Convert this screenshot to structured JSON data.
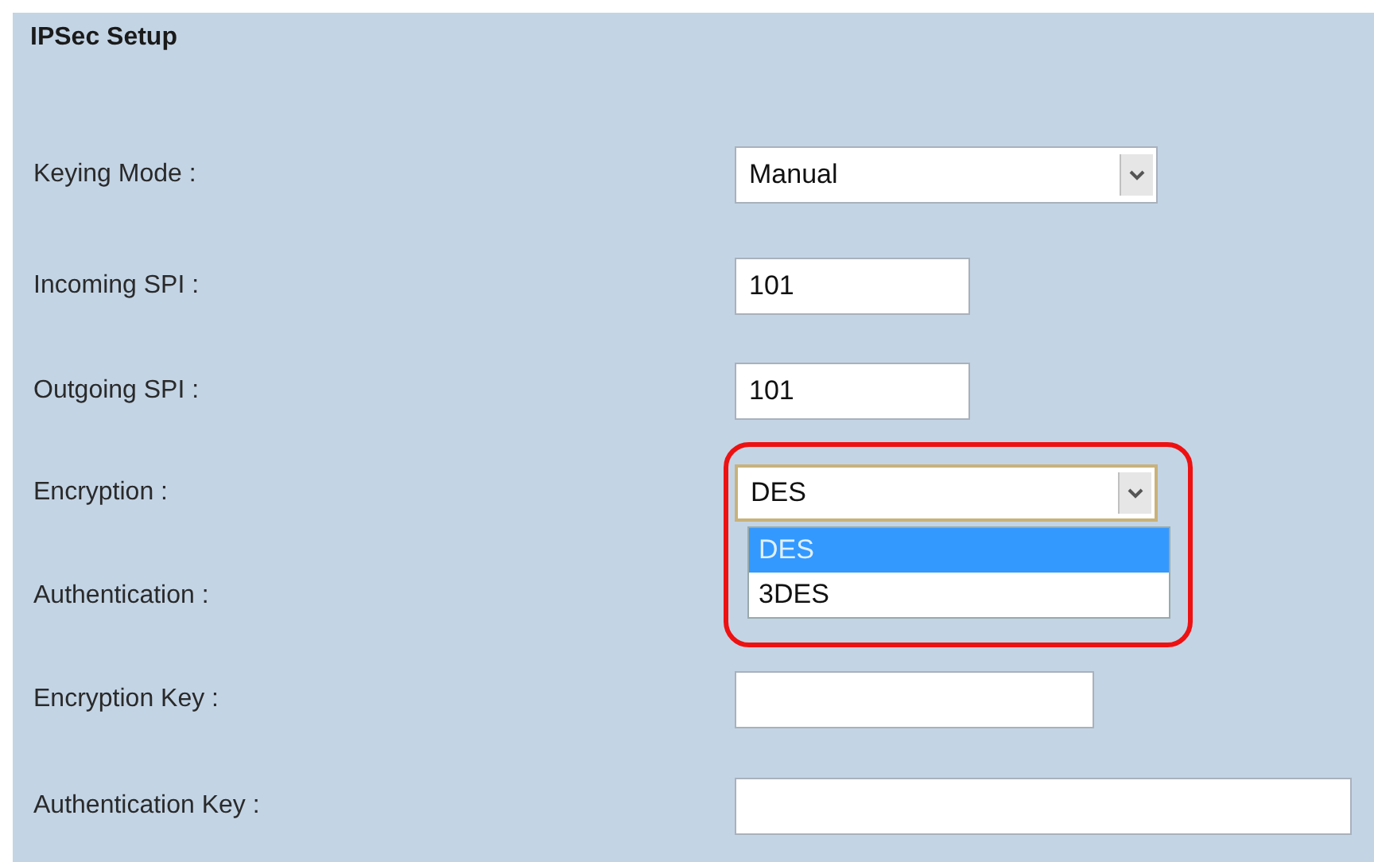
{
  "panel": {
    "title": "IPSec Setup"
  },
  "rows": [
    {
      "label": "Keying Mode :",
      "kind": "select",
      "value": "Manual"
    },
    {
      "label": "Incoming SPI :",
      "kind": "text",
      "value": "101"
    },
    {
      "label": "Outgoing SPI :",
      "kind": "text",
      "value": "101"
    },
    {
      "label": "Encryption :",
      "kind": "select",
      "value": "DES",
      "focused": true,
      "options": [
        {
          "label": "DES",
          "selected": true
        },
        {
          "label": "3DES",
          "selected": false
        }
      ]
    },
    {
      "label": "Authentication :",
      "kind": "hidden"
    },
    {
      "label": "Encryption Key :",
      "kind": "text"
    },
    {
      "label": "Authentication Key :",
      "kind": "text"
    }
  ]
}
